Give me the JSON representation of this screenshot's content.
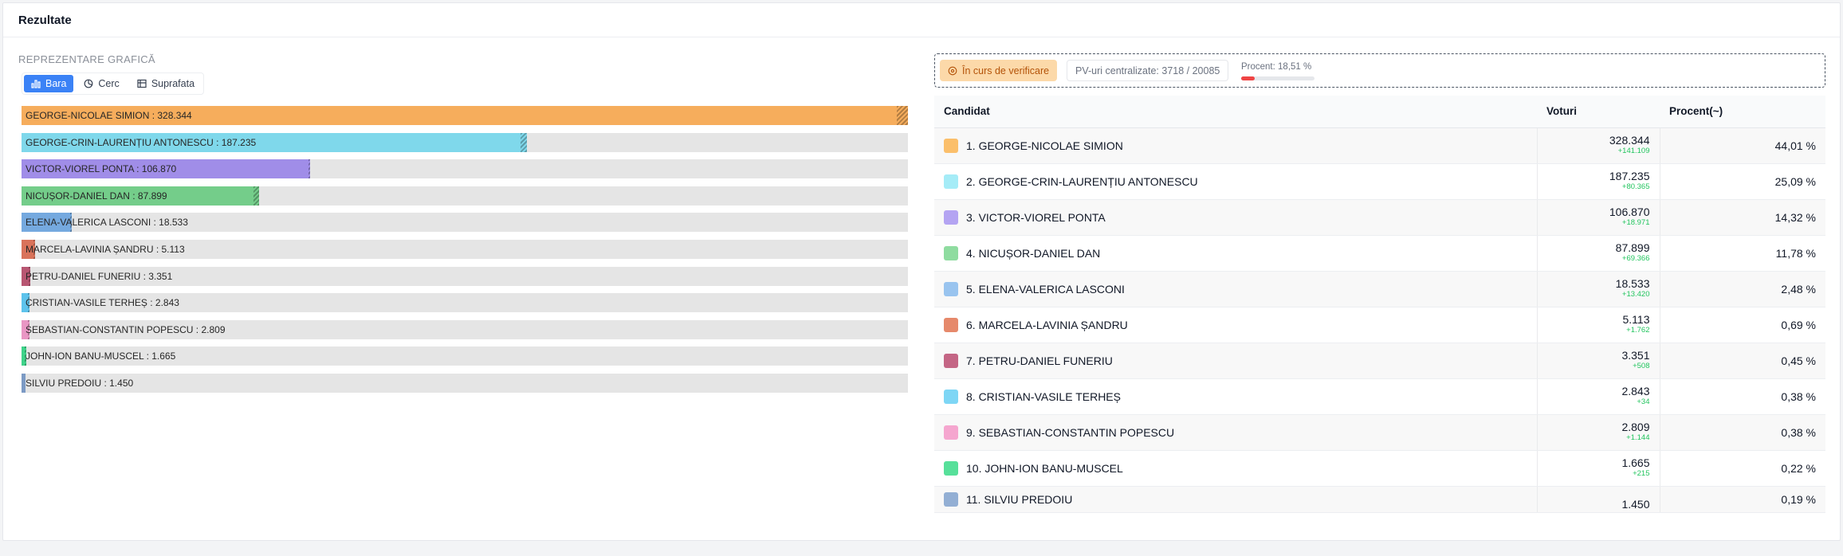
{
  "panel": {
    "title": "Rezultate"
  },
  "chart": {
    "section_label": "REPREZENTARE GRAFICĂ",
    "views": [
      {
        "label": "Bara",
        "icon": "bar-chart-icon",
        "active": true
      },
      {
        "label": "Cerc",
        "icon": "pie-chart-icon",
        "active": false
      },
      {
        "label": "Suprafata",
        "icon": "area-chart-icon",
        "active": false
      }
    ]
  },
  "status": {
    "badge": "În curs de verificare",
    "pv": "PV-uri centralizate: 3718 / 20085",
    "procent": "Procent: 18,51 %",
    "procent_value": 18.51
  },
  "table": {
    "headers": {
      "candidat": "Candidat",
      "voturi": "Voturi",
      "procent": "Procent(~)"
    }
  },
  "chart_data": {
    "type": "bar",
    "orientation": "horizontal",
    "max_value": 328344,
    "categories": [
      "GEORGE-NICOLAE SIMION",
      "GEORGE-CRIN-LAURENȚIU ANTONESCU",
      "VICTOR-VIOREL PONTA",
      "NICUȘOR-DANIEL DAN",
      "ELENA-VALERICA LASCONI",
      "MARCELA-LAVINIA ȘANDRU",
      "PETRU-DANIEL FUNERIU",
      "CRISTIAN-VASILE TERHEȘ",
      "SEBASTIAN-CONSTANTIN POPESCU",
      "JOHN-ION BANU-MUSCEL",
      "SILVIU PREDOIU"
    ],
    "values": [
      328344,
      187235,
      106870,
      87899,
      18533,
      5113,
      3351,
      2843,
      2809,
      1665,
      1450
    ],
    "value_labels": [
      "328.344",
      "187.235",
      "106.870",
      "87.899",
      "18.533",
      "5.113",
      "3.351",
      "2.843",
      "2.809",
      "1.665",
      "1.450"
    ],
    "increments": [
      141109,
      80365,
      18971,
      69366,
      13420,
      1762,
      508,
      34,
      1144,
      215,
      null
    ],
    "increment_labels": [
      "+141.109",
      "+80.365",
      "+18.971",
      "+69.366",
      "+13.420",
      "+1.762",
      "+508",
      "+34",
      "+1.144",
      "+215",
      ""
    ],
    "percent_labels": [
      "44,01 %",
      "25,09 %",
      "14,32 %",
      "11,78 %",
      "2,48 %",
      "0,69 %",
      "0,45 %",
      "0,38 %",
      "0,38 %",
      "0,22 %",
      "0,19 %"
    ],
    "colors": [
      "#f6ad5c",
      "#7fd8eb",
      "#a08de8",
      "#74cd8a",
      "#75a9df",
      "#d9735a",
      "#b85672",
      "#5dc3ec",
      "#e996c4",
      "#3fd38a",
      "#7c9ac4"
    ],
    "swatch_colors": [
      "#fbbf6b",
      "#a5ecf7",
      "#b4a4f2",
      "#8fdca0",
      "#99c4ef",
      "#e6896b",
      "#c46685",
      "#7ed6f5",
      "#f5a6cf",
      "#57e09a",
      "#93afd4"
    ]
  }
}
